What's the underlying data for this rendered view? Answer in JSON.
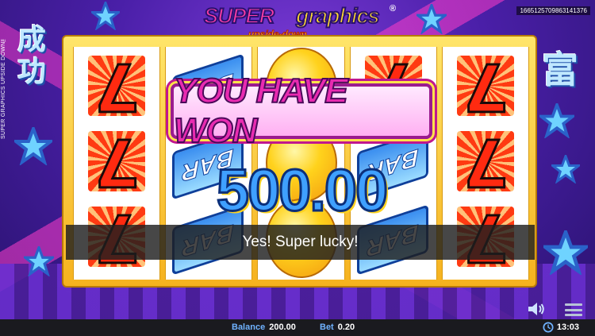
{
  "game": {
    "logo_word_1": "SUPER",
    "logo_word_2": "graphics",
    "logo_subtitle": "upside-down",
    "logo_reg_mark": "®",
    "vertical_title": "SUPER GRAPHICS UPSIDE DOWN™",
    "game_id": "1665125709863141376",
    "left_chars": "成功",
    "right_char": "富"
  },
  "reels": [
    {
      "symbols": [
        "seven-up",
        "seven-up",
        "seven-up"
      ]
    },
    {
      "symbols": [
        "bar",
        "bar",
        "bar"
      ]
    },
    {
      "symbols": [
        "lemon",
        "lemon",
        "lemon"
      ]
    },
    {
      "symbols": [
        "seven-up",
        "bar",
        "bar"
      ]
    },
    {
      "symbols": [
        "seven-up",
        "seven-up",
        "seven-up"
      ]
    }
  ],
  "win": {
    "banner_text": "YOU HAVE WON",
    "amount": "500.00"
  },
  "subtitle": {
    "text": "Yes! Super lucky!"
  },
  "bottom_bar": {
    "balance_label": "Balance",
    "balance_value": "200.00",
    "bet_label": "Bet",
    "bet_value": "0.20",
    "time": "13:03"
  },
  "colors": {
    "background": "#4a1fa8",
    "frame": "#f6b21e",
    "accent_pink": "#e82bb0",
    "win_amount": "#3fa0ff",
    "label_blue": "#6fb2ff"
  },
  "icons": {
    "sound": "speaker-icon",
    "menu": "hamburger-menu-icon",
    "clock": "clock-icon"
  }
}
